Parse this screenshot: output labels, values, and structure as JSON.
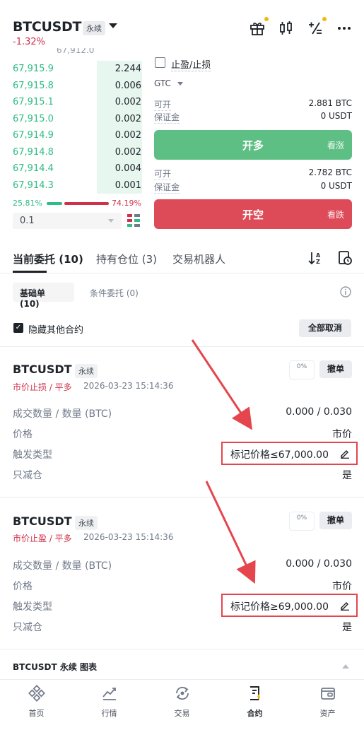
{
  "header": {
    "symbol": "BTCUSDT",
    "contract_badge": "永续",
    "change": "-1.32%",
    "icons": [
      "gift-icon",
      "candlestick-icon",
      "calculator-icon",
      "more-icon"
    ]
  },
  "orderbook": {
    "cut_price": "67,912.0",
    "rows": [
      {
        "price": "67,915.9",
        "qty": "2.244"
      },
      {
        "price": "67,915.8",
        "qty": "0.006"
      },
      {
        "price": "67,915.1",
        "qty": "0.002"
      },
      {
        "price": "67,915.0",
        "qty": "0.002"
      },
      {
        "price": "67,914.9",
        "qty": "0.002"
      },
      {
        "price": "67,914.8",
        "qty": "0.002"
      },
      {
        "price": "67,914.4",
        "qty": "0.004"
      },
      {
        "price": "67,914.3",
        "qty": "0.001"
      }
    ],
    "buy_ratio": "25.81%",
    "sell_ratio": "74.19%",
    "depth_step": "0.1"
  },
  "form": {
    "tp_sl_label": "止盈/止损",
    "tif": "GTC",
    "long": {
      "avail_label": "可开",
      "avail_value": "2.881 BTC",
      "margin_label": "保证金",
      "margin_value": "0 USDT",
      "button": "开多",
      "side": "看涨"
    },
    "short": {
      "avail_label": "可开",
      "avail_value": "2.782 BTC",
      "margin_label": "保证金",
      "margin_value": "0 USDT",
      "button": "开空",
      "side": "看跌"
    }
  },
  "tabs": {
    "open_orders": "当前委托 (10)",
    "positions": "持有仓位 (3)",
    "bots": "交易机器人"
  },
  "subtabs": {
    "basic": "基础单 (10)",
    "conditional": "条件委托 (0)"
  },
  "hide_other": "隐藏其他合约",
  "cancel_all": "全部取消",
  "orders": [
    {
      "symbol": "BTCUSDT",
      "badge": "永续",
      "type": "市价止损 / 平多",
      "time": "2026-03-23 15:14:36",
      "progress": "0%",
      "cancel": "撤单",
      "filled_label": "成交数量 / 数量 (BTC)",
      "filled_value": "0.000 / 0.030",
      "price_label": "价格",
      "price_value": "市价",
      "trigger_label": "触发类型",
      "trigger_value": "标记价格≤67,000.00",
      "reduce_label": "只减仓",
      "reduce_value": "是"
    },
    {
      "symbol": "BTCUSDT",
      "badge": "永续",
      "type": "市价止盈 / 平多",
      "time": "2026-03-23 15:14:36",
      "progress": "0%",
      "cancel": "撤单",
      "filled_label": "成交数量 / 数量 (BTC)",
      "filled_value": "0.000 / 0.030",
      "price_label": "价格",
      "price_value": "市价",
      "trigger_label": "触发类型",
      "trigger_value": "标记价格≥69,000.00",
      "reduce_label": "只减仓",
      "reduce_value": "是"
    }
  ],
  "chart_bar": "BTCUSDT 永续 图表",
  "nav": [
    {
      "label": "首页",
      "icon": "binance-logo-icon"
    },
    {
      "label": "行情",
      "icon": "market-chart-icon"
    },
    {
      "label": "交易",
      "icon": "trade-swap-icon"
    },
    {
      "label": "合约",
      "icon": "futures-doc-icon"
    },
    {
      "label": "资产",
      "icon": "wallet-icon"
    }
  ],
  "colors": {
    "green": "#2ebd85",
    "red": "#cf304a",
    "highlight": "#e5454d",
    "accent": "#f0b90b"
  }
}
